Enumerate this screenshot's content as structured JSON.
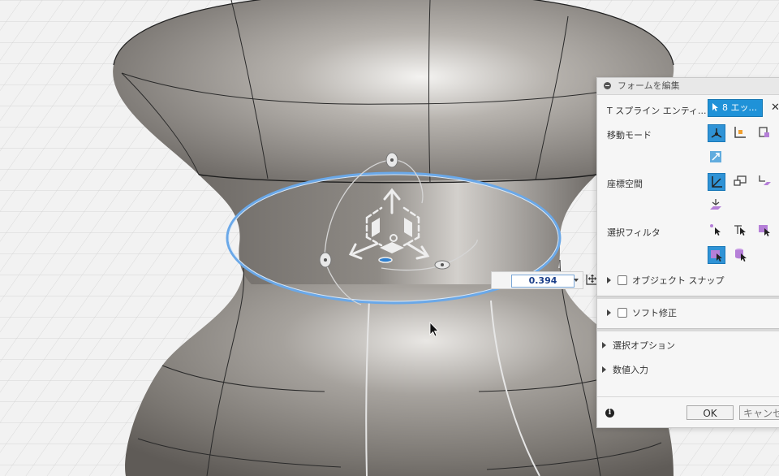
{
  "panel": {
    "title": "フォームを編集",
    "selection_label": "T スプライン エンティ...",
    "selection_button": "8 エッ...",
    "close": "✕",
    "move_mode_label": "移動モード",
    "coord_space_label": "座標空間",
    "selection_filter_label": "選択フィルタ",
    "object_snap_label": "オブジェクト スナップ",
    "soft_modify_label": "ソフト修正",
    "selection_options_label": "選択オプション",
    "numeric_input_label": "数値入力",
    "ok_label": "OK",
    "cancel_label": "キャンセル"
  },
  "value_box": {
    "value": "0.394"
  },
  "colors": {
    "accent": "#2f93d6",
    "selection_edge": "#6aa8e8",
    "model_body": "#8d8984",
    "grid": "#c8c8c8"
  },
  "icons": [
    "minimize-icon",
    "cursor-icon",
    "close-icon",
    "free-move-icon",
    "along-axis-icon",
    "plane-move-icon",
    "scale-icon",
    "world-space-icon",
    "view-space-icon",
    "local-space-icon",
    "parallel-space-icon",
    "vertex-filter-icon",
    "edge-filter-icon",
    "face-filter-icon",
    "body-filter-icon",
    "solid-filter-icon",
    "checkbox-icon",
    "triangle-right-icon",
    "info-icon",
    "dropdown-arrow-icon",
    "move-handle-icon",
    "mouse-cursor-icon"
  ]
}
